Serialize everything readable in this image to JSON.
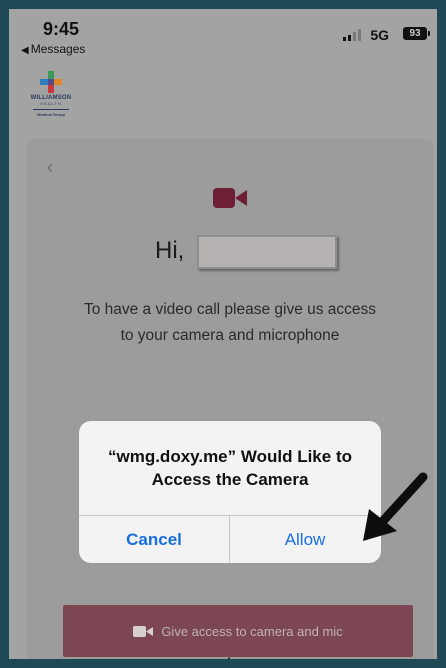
{
  "status_bar": {
    "time": "9:45",
    "back_label": "Messages",
    "network": "5G",
    "battery": "93"
  },
  "logo": {
    "name": "WILLIAMSON",
    "sub": "HEALTH",
    "group": "Medical Group"
  },
  "page": {
    "greeting": "Hi,",
    "message_line1": "To have a video call please give us access",
    "message_line2": "to your camera and microphone",
    "give_access_label": "Give access to camera and mic"
  },
  "alert": {
    "title_line1": "“wmg.doxy.me” Would Like to",
    "title_line2": "Access the Camera",
    "cancel_label": "Cancel",
    "allow_label": "Allow"
  },
  "colors": {
    "brand_maroon": "#6e1f35",
    "ios_blue": "#1a6fe0",
    "frame": "#1f4a55"
  }
}
